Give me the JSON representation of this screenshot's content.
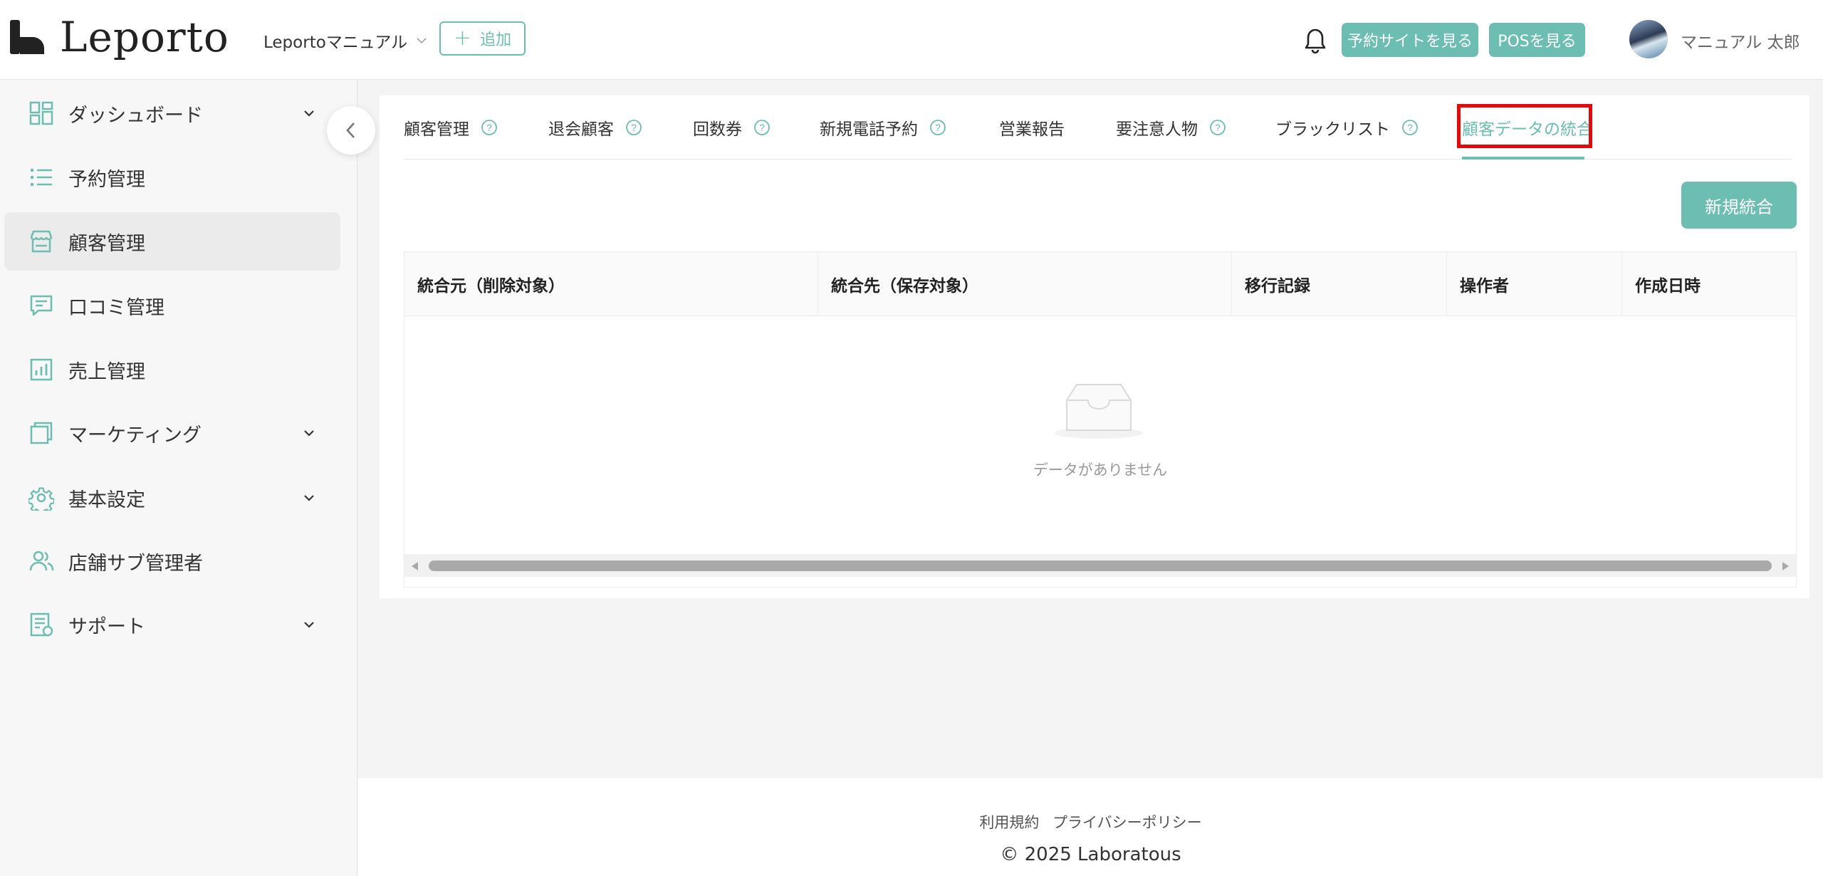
{
  "header": {
    "logo_text": "Leporto",
    "store_name": "Leportoマニュアル",
    "add_label": "追加",
    "view_site_label": "予約サイトを見る",
    "view_pos_label": "POSを見る",
    "user_name": "マニュアル 太郎"
  },
  "sidebar": {
    "items": [
      {
        "label": "ダッシュボード",
        "icon": "dashboard-icon"
      },
      {
        "label": "予約管理",
        "icon": "list-icon"
      },
      {
        "label": "顧客管理",
        "icon": "store-icon"
      },
      {
        "label": "口コミ管理",
        "icon": "comment-icon"
      },
      {
        "label": "売上管理",
        "icon": "chart-icon"
      },
      {
        "label": "マーケティング",
        "icon": "layers-icon"
      },
      {
        "label": "基本設定",
        "icon": "gear-icon"
      },
      {
        "label": "店舗サブ管理者",
        "icon": "users-icon"
      },
      {
        "label": "サポート",
        "icon": "document-icon"
      }
    ]
  },
  "tabs": [
    {
      "label": "顧客管理"
    },
    {
      "label": "退会顧客"
    },
    {
      "label": "回数券"
    },
    {
      "label": "新規電話予約"
    },
    {
      "label": "営業報告"
    },
    {
      "label": "要注意人物"
    },
    {
      "label": "ブラックリスト"
    },
    {
      "label": "顧客データの統合"
    }
  ],
  "actions": {
    "new_merge_label": "新規統合"
  },
  "table": {
    "columns": [
      "統合元（削除対象）",
      "統合先（保存対象）",
      "移行記録",
      "操作者",
      "作成日時"
    ],
    "empty_text": "データがありません"
  },
  "footer": {
    "terms": "利用規約",
    "privacy": "プライバシーポリシー",
    "copyright": "© 2025 Laboratous"
  },
  "colors": {
    "accent": "#6cbdb2",
    "highlight": "#e20a0a"
  }
}
